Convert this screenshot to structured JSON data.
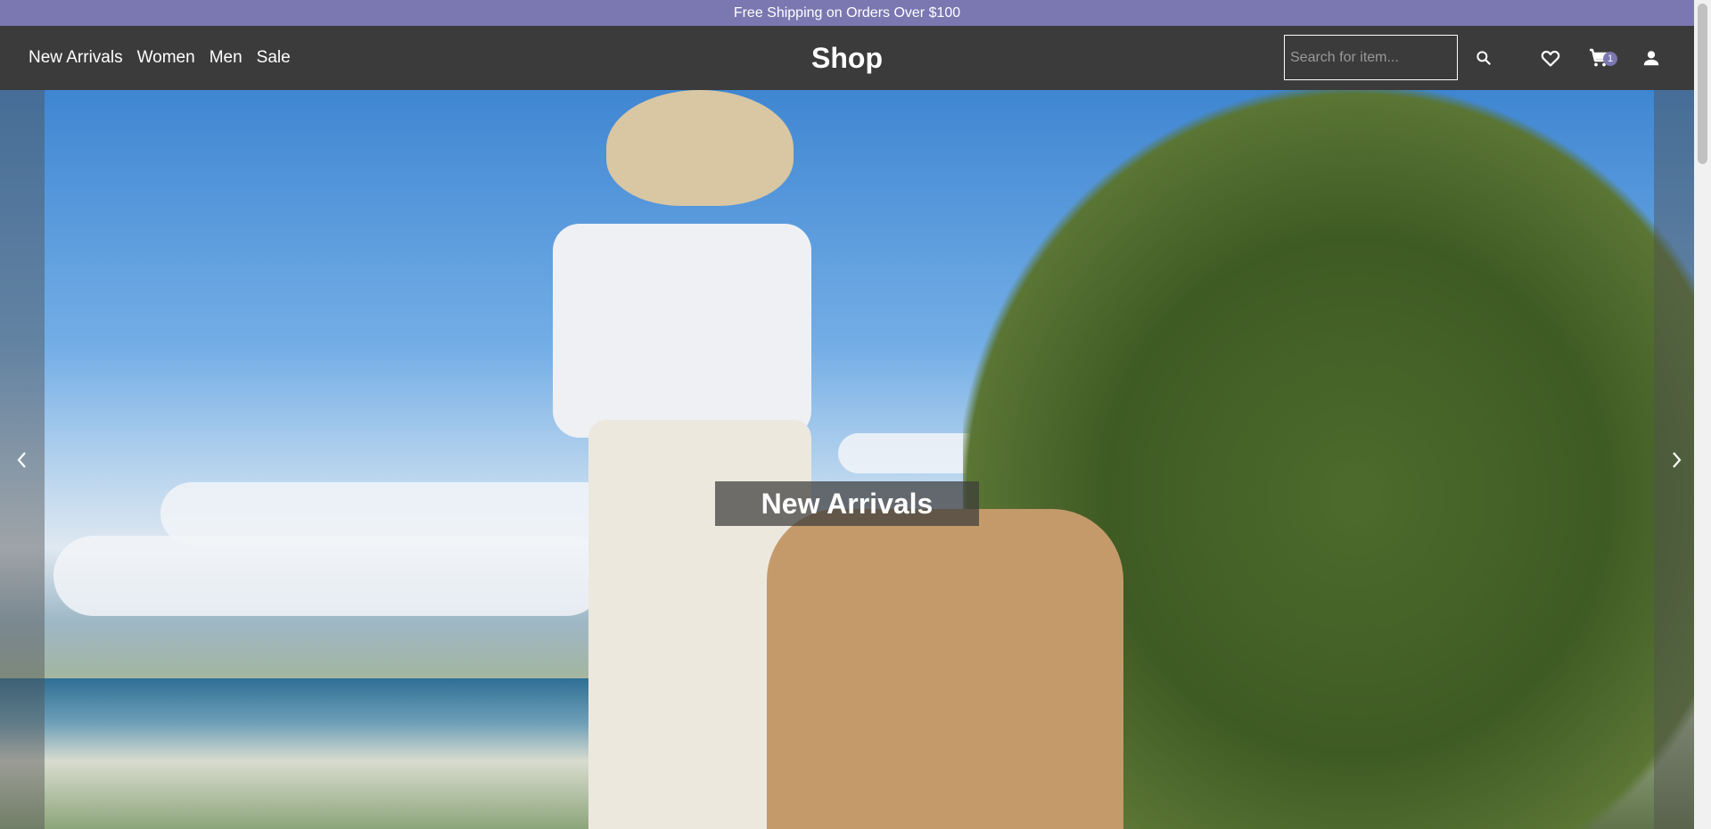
{
  "promo": {
    "text": "Free Shipping on Orders Over $100"
  },
  "header": {
    "nav": [
      {
        "label": "New Arrivals"
      },
      {
        "label": "Women"
      },
      {
        "label": "Men"
      },
      {
        "label": "Sale"
      }
    ],
    "brand": "Shop",
    "search": {
      "placeholder": "Search for item...",
      "value": ""
    },
    "icons": [
      "search-icon",
      "heart-icon",
      "cart-icon",
      "user-icon"
    ],
    "cart_count": "1"
  },
  "hero": {
    "caption": "New Arrivals",
    "arrows": [
      "chevron-left-icon",
      "chevron-right-icon"
    ]
  },
  "colors": {
    "promo_bg": "#7a77b1",
    "header_bg": "#3b3b3b",
    "badge_bg": "#7a77b1",
    "text": "#ffffff"
  }
}
